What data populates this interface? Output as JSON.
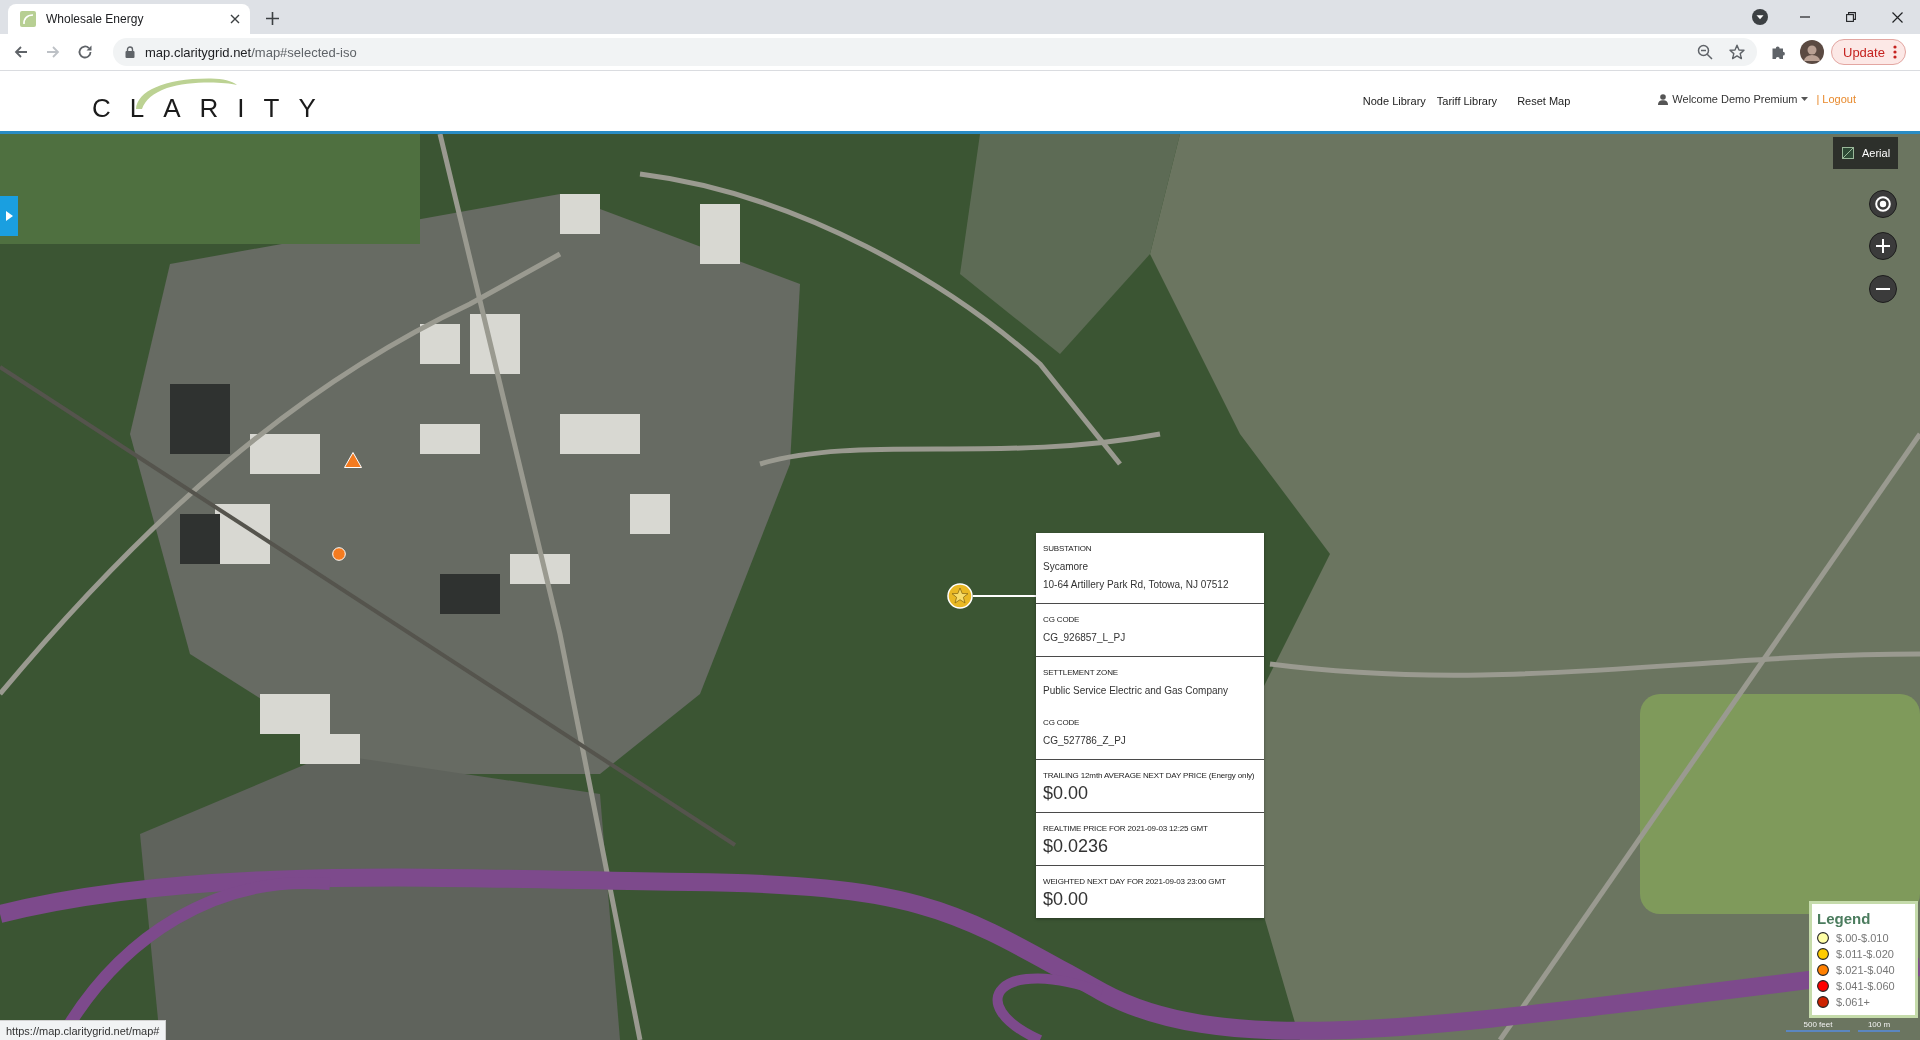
{
  "browser": {
    "tabs": [
      {
        "title": "Wholesale Energy",
        "selected": true
      }
    ],
    "nav_buttons": [
      {
        "kind": "back",
        "disabled": false
      },
      {
        "kind": "forward",
        "disabled": true
      },
      {
        "kind": "reload",
        "disabled": false
      }
    ],
    "url": {
      "host": "map.claritygrid.net",
      "path": "/map#selected-iso"
    },
    "update_button": "Update",
    "status_url": "https://map.claritygrid.net/map#"
  },
  "header": {
    "logo": "CLARITY",
    "nav": [
      "Node Library",
      "Tariff Library",
      "Reset Map"
    ],
    "user_menu": "Welcome Demo Premium",
    "logout": "| Logout"
  },
  "map": {
    "aerial_button": "Aerial",
    "markers": [
      {
        "kind": "triangle",
        "color": "#f47b20"
      },
      {
        "kind": "circle",
        "color": "#f47b20"
      },
      {
        "kind": "star",
        "color": "#e9b824"
      }
    ],
    "popup": {
      "sections": [
        {
          "entries": [
            {
              "kind": "text",
              "label": "SUBSTATION",
              "lines": [
                "Sycamore",
                "10-64 Artillery Park Rd, Totowa, NJ 07512"
              ]
            }
          ]
        },
        {
          "entries": [
            {
              "kind": "text",
              "label": "CG CODE",
              "lines": [
                "CG_926857_L_PJ"
              ]
            }
          ]
        },
        {
          "entries": [
            {
              "kind": "text",
              "label": "SETTLEMENT ZONE",
              "lines": [
                "Public Service Electric and Gas Company"
              ]
            },
            {
              "kind": "text",
              "label": "CG CODE",
              "lines": [
                "CG_527786_Z_PJ"
              ]
            }
          ]
        },
        {
          "entries": [
            {
              "kind": "price",
              "label": "TRAILING 12mth AVERAGE NEXT DAY PRICE (Energy only)",
              "lines": [
                "$0.00"
              ]
            }
          ]
        },
        {
          "entries": [
            {
              "kind": "price",
              "label": "REALTIME PRICE FOR 2021-09-03 12:25 GMT",
              "lines": [
                "$0.0236"
              ]
            }
          ]
        },
        {
          "entries": [
            {
              "kind": "price",
              "label": "WEIGHTED NEXT DAY FOR 2021-09-03 23:00 GMT",
              "lines": [
                "$0.00"
              ]
            }
          ]
        }
      ]
    },
    "legend": {
      "title": "Legend",
      "items": [
        {
          "label": "$.00-$.010",
          "color": "#ffffa6"
        },
        {
          "label": "$.011-$.020",
          "color": "#ffcc00"
        },
        {
          "label": "$.021-$.040",
          "color": "#ff8000"
        },
        {
          "label": "$.041-$.060",
          "color": "#ff0000"
        },
        {
          "label": "$.061+",
          "color": "#cc2200"
        }
      ]
    },
    "scale_bar": [
      "500 feet",
      "100 m"
    ]
  }
}
